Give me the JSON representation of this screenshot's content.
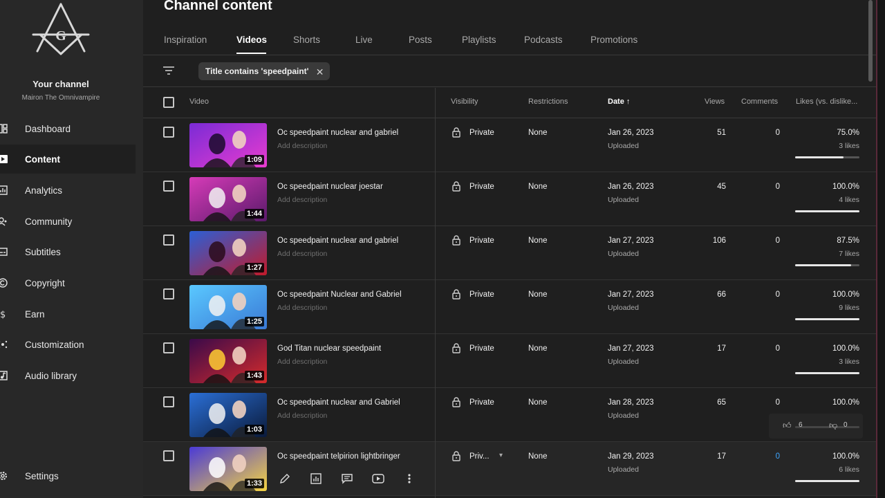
{
  "sidebar": {
    "channel_name": "Your channel",
    "channel_handle": "Mairon The Omnivampire",
    "logo_letter": "G",
    "items": [
      {
        "label": "Dashboard",
        "icon": "dashboard-icon"
      },
      {
        "label": "Content",
        "icon": "content-icon",
        "active": true
      },
      {
        "label": "Analytics",
        "icon": "analytics-icon"
      },
      {
        "label": "Community",
        "icon": "community-icon"
      },
      {
        "label": "Subtitles",
        "icon": "subtitles-icon"
      },
      {
        "label": "Copyright",
        "icon": "copyright-icon"
      },
      {
        "label": "Earn",
        "icon": "earn-icon"
      },
      {
        "label": "Customization",
        "icon": "customization-icon"
      },
      {
        "label": "Audio library",
        "icon": "audio-library-icon"
      }
    ],
    "settings_label": "Settings"
  },
  "header": {
    "title": "Channel content"
  },
  "tabs": [
    "Inspiration",
    "Videos",
    "Shorts",
    "Live",
    "Posts",
    "Playlists",
    "Podcasts",
    "Promotions"
  ],
  "active_tab": "Videos",
  "filter": {
    "chip_label": "Title contains 'speedpaint'"
  },
  "table": {
    "columns": {
      "video": "Video",
      "visibility": "Visibility",
      "restrictions": "Restrictions",
      "date": "Date",
      "views": "Views",
      "comments": "Comments",
      "likes": "Likes (vs. dislike..."
    },
    "rows": [
      {
        "title": "Oc speedpaint nuclear and gabriel",
        "description": "Add description",
        "duration": "1:09",
        "visibility": "Private",
        "restrictions": "None",
        "date": "Jan 26, 2023",
        "status": "Uploaded",
        "views": "51",
        "comments": "0",
        "likes_pct": "75.0%",
        "likes_count": "3 likes",
        "ratio": 0.75
      },
      {
        "title": "Oc speedpaint nuclear joestar",
        "description": "Add description",
        "duration": "1:44",
        "visibility": "Private",
        "restrictions": "None",
        "date": "Jan 26, 2023",
        "status": "Uploaded",
        "views": "45",
        "comments": "0",
        "likes_pct": "100.0%",
        "likes_count": "4 likes",
        "ratio": 1.0
      },
      {
        "title": "Oc speedpaint nuclear and gabriel",
        "description": "Add description",
        "duration": "1:27",
        "visibility": "Private",
        "restrictions": "None",
        "date": "Jan 27, 2023",
        "status": "Uploaded",
        "views": "106",
        "comments": "0",
        "likes_pct": "87.5%",
        "likes_count": "7 likes",
        "ratio": 0.875
      },
      {
        "title": "Oc speedpaint Nuclear and Gabriel",
        "description": "Add description",
        "duration": "1:25",
        "visibility": "Private",
        "restrictions": "None",
        "date": "Jan 27, 2023",
        "status": "Uploaded",
        "views": "66",
        "comments": "0",
        "likes_pct": "100.0%",
        "likes_count": "9 likes",
        "ratio": 1.0
      },
      {
        "title": "God Titan nuclear speedpaint",
        "description": "Add description",
        "duration": "1:43",
        "visibility": "Private",
        "restrictions": "None",
        "date": "Jan 27, 2023",
        "status": "Uploaded",
        "views": "17",
        "comments": "0",
        "likes_pct": "100.0%",
        "likes_count": "3 likes",
        "ratio": 1.0
      },
      {
        "title": "Oc speedpaint nuclear and Gabriel",
        "description": "Add description",
        "duration": "1:03",
        "visibility": "Private",
        "restrictions": "None",
        "date": "Jan 28, 2023",
        "status": "Uploaded",
        "views": "65",
        "comments": "0",
        "likes_pct": "100.0%",
        "likes_count": "",
        "ratio": 1.0
      },
      {
        "title": "Oc speedpaint telpirion lightbringer",
        "description": "",
        "duration": "1:33",
        "visibility": "Priv...",
        "restrictions": "None",
        "date": "Jan 29, 2023",
        "status": "Uploaded",
        "views": "17",
        "comments": "0",
        "likes_pct": "100.0%",
        "likes_count": "6 likes",
        "ratio": 1.0
      }
    ]
  },
  "hover_tooltip": {
    "likes": "6",
    "dislikes": "0"
  },
  "colors": {
    "accent_link": "#3ea6ff",
    "background": "#1f1f1f",
    "sidebar": "#282828"
  }
}
